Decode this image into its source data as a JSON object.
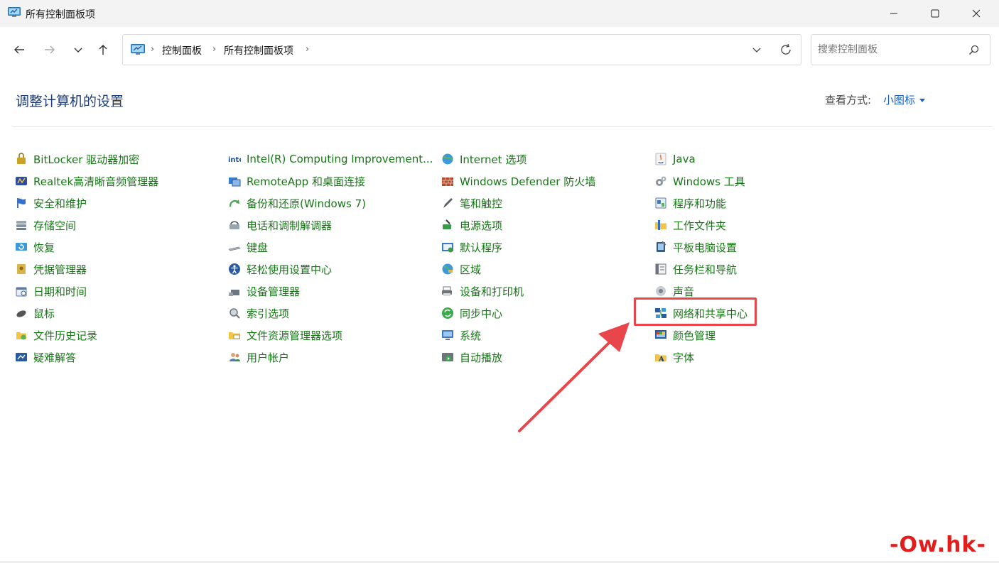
{
  "window": {
    "title": "所有控制面板项",
    "icon": "control-panel-icon"
  },
  "nav": {
    "breadcrumbs": [
      "控制面板",
      "所有控制面板项"
    ],
    "search_placeholder": "搜索控制面板"
  },
  "header": {
    "title": "调整计算机的设置",
    "view_label": "查看方式:",
    "view_value": "小图标"
  },
  "columns": [
    {
      "items": [
        {
          "label": "BitLocker 驱动器加密",
          "icon": "bitlocker-icon"
        },
        {
          "label": "Realtek高清晰音频管理器",
          "icon": "realtek-audio-icon"
        },
        {
          "label": "安全和维护",
          "icon": "flag-icon"
        },
        {
          "label": "存储空间",
          "icon": "storage-icon"
        },
        {
          "label": "恢复",
          "icon": "recovery-icon"
        },
        {
          "label": "凭据管理器",
          "icon": "credential-icon"
        },
        {
          "label": "日期和时间",
          "icon": "datetime-icon"
        },
        {
          "label": "鼠标",
          "icon": "mouse-icon"
        },
        {
          "label": "文件历史记录",
          "icon": "file-history-icon"
        },
        {
          "label": "疑难解答",
          "icon": "troubleshoot-icon"
        }
      ]
    },
    {
      "items": [
        {
          "label": "Intel(R) Computing Improvement...",
          "icon": "intel-icon"
        },
        {
          "label": "RemoteApp 和桌面连接",
          "icon": "remoteapp-icon"
        },
        {
          "label": "备份和还原(Windows 7)",
          "icon": "backup-icon"
        },
        {
          "label": "电话和调制解调器",
          "icon": "phone-modem-icon"
        },
        {
          "label": "键盘",
          "icon": "keyboard-icon"
        },
        {
          "label": "轻松使用设置中心",
          "icon": "ease-of-access-icon"
        },
        {
          "label": "设备管理器",
          "icon": "device-manager-icon"
        },
        {
          "label": "索引选项",
          "icon": "indexing-icon"
        },
        {
          "label": "文件资源管理器选项",
          "icon": "folder-options-icon"
        },
        {
          "label": "用户帐户",
          "icon": "user-accounts-icon"
        }
      ]
    },
    {
      "items": [
        {
          "label": "Internet 选项",
          "icon": "internet-globe-icon"
        },
        {
          "label": "Windows Defender 防火墙",
          "icon": "firewall-icon"
        },
        {
          "label": "笔和触控",
          "icon": "pen-icon"
        },
        {
          "label": "电源选项",
          "icon": "power-options-icon"
        },
        {
          "label": "默认程序",
          "icon": "default-programs-icon"
        },
        {
          "label": "区域",
          "icon": "region-globe-icon"
        },
        {
          "label": "设备和打印机",
          "icon": "printer-icon"
        },
        {
          "label": "同步中心",
          "icon": "sync-icon"
        },
        {
          "label": "系统",
          "icon": "system-monitor-icon"
        },
        {
          "label": "自动播放",
          "icon": "autoplay-icon"
        }
      ]
    },
    {
      "items": [
        {
          "label": "Java",
          "icon": "java-icon"
        },
        {
          "label": "Windows 工具",
          "icon": "windows-tools-icon"
        },
        {
          "label": "程序和功能",
          "icon": "programs-features-icon"
        },
        {
          "label": "工作文件夹",
          "icon": "work-folders-icon"
        },
        {
          "label": "平板电脑设置",
          "icon": "tablet-icon"
        },
        {
          "label": "任务栏和导航",
          "icon": "taskbar-icon"
        },
        {
          "label": "声音",
          "icon": "speaker-icon"
        },
        {
          "label": "网络和共享中心",
          "icon": "network-icon"
        },
        {
          "label": "颜色管理",
          "icon": "color-management-icon"
        },
        {
          "label": "字体",
          "icon": "fonts-icon"
        }
      ]
    }
  ],
  "annotation": {
    "highlight_color": "#e8464a",
    "watermark": "-Ow.hk-"
  },
  "colors": {
    "link_green": "#167616",
    "title_blue": "#1e3d7a",
    "accent_blue": "#1661c4"
  }
}
